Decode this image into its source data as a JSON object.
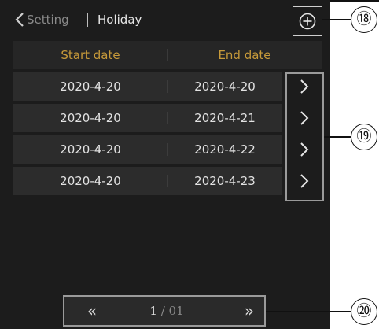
{
  "header": {
    "back_icon": "chevron-left-icon",
    "breadcrumb_parent": "Setting",
    "breadcrumb_current": "Holiday",
    "add_icon": "circle-plus-icon"
  },
  "table": {
    "columns": [
      "Start date",
      "End date"
    ],
    "rows": [
      {
        "start": "2020-4-20",
        "end": "2020-4-20"
      },
      {
        "start": "2020-4-20",
        "end": "2020-4-21"
      },
      {
        "start": "2020-4-20",
        "end": "2020-4-22"
      },
      {
        "start": "2020-4-20",
        "end": "2020-4-23"
      }
    ],
    "row_action_icon": "chevron-right-icon"
  },
  "pager": {
    "first_icon": "double-chevron-left-icon",
    "next_icon": "double-chevron-right-icon",
    "first_glyph": "«",
    "next_glyph": "»",
    "current": "1",
    "separator": "/",
    "total": "01"
  },
  "callouts": [
    "⑱",
    "⑲",
    "⑳"
  ],
  "colors": {
    "background": "#1c1c1c",
    "header_accent": "#c79a3a",
    "row_bg": "#2c2c2c",
    "text": "#e2e2e2"
  }
}
